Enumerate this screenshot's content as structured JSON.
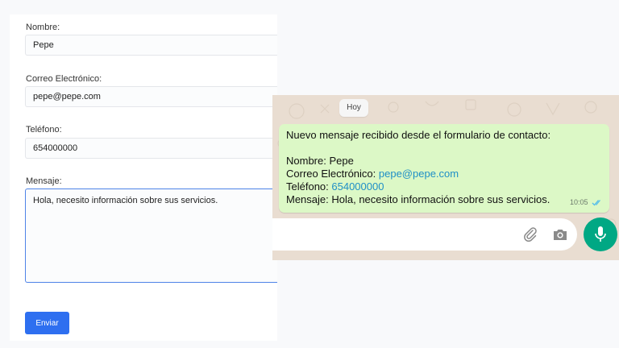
{
  "form": {
    "name_label": "Nombre:",
    "name_value": "Pepe",
    "email_label": "Correo Electrónico:",
    "email_value": "pepe@pepe.com",
    "phone_label": "Teléfono:",
    "phone_value": "654000000",
    "message_label": "Mensaje:",
    "message_value": "Hola, necesito información sobre sus servicios.",
    "submit_label": "Enviar"
  },
  "chat": {
    "date_chip": "Hoy",
    "message": {
      "header": "Nuevo mensaje recibido desde el formulario de contacto:",
      "name_line": "Nombre: Pepe",
      "email_prefix": "Correo Electrónico: ",
      "email_link": "pepe@pepe.com",
      "phone_prefix": "Teléfono: ",
      "phone_link": "654000000",
      "message_line": "Mensaje: Hola, necesito información sobre sus servicios.",
      "time": "10:05"
    },
    "icons": {
      "attach": "paperclip-icon",
      "camera": "camera-icon",
      "mic": "microphone-icon",
      "read_status": "double-check-icon"
    },
    "colors": {
      "bubble": "#dcf8c6",
      "mic_button": "#00a884",
      "link": "#1f8fc6",
      "submit_button": "#2e6ff0"
    }
  }
}
